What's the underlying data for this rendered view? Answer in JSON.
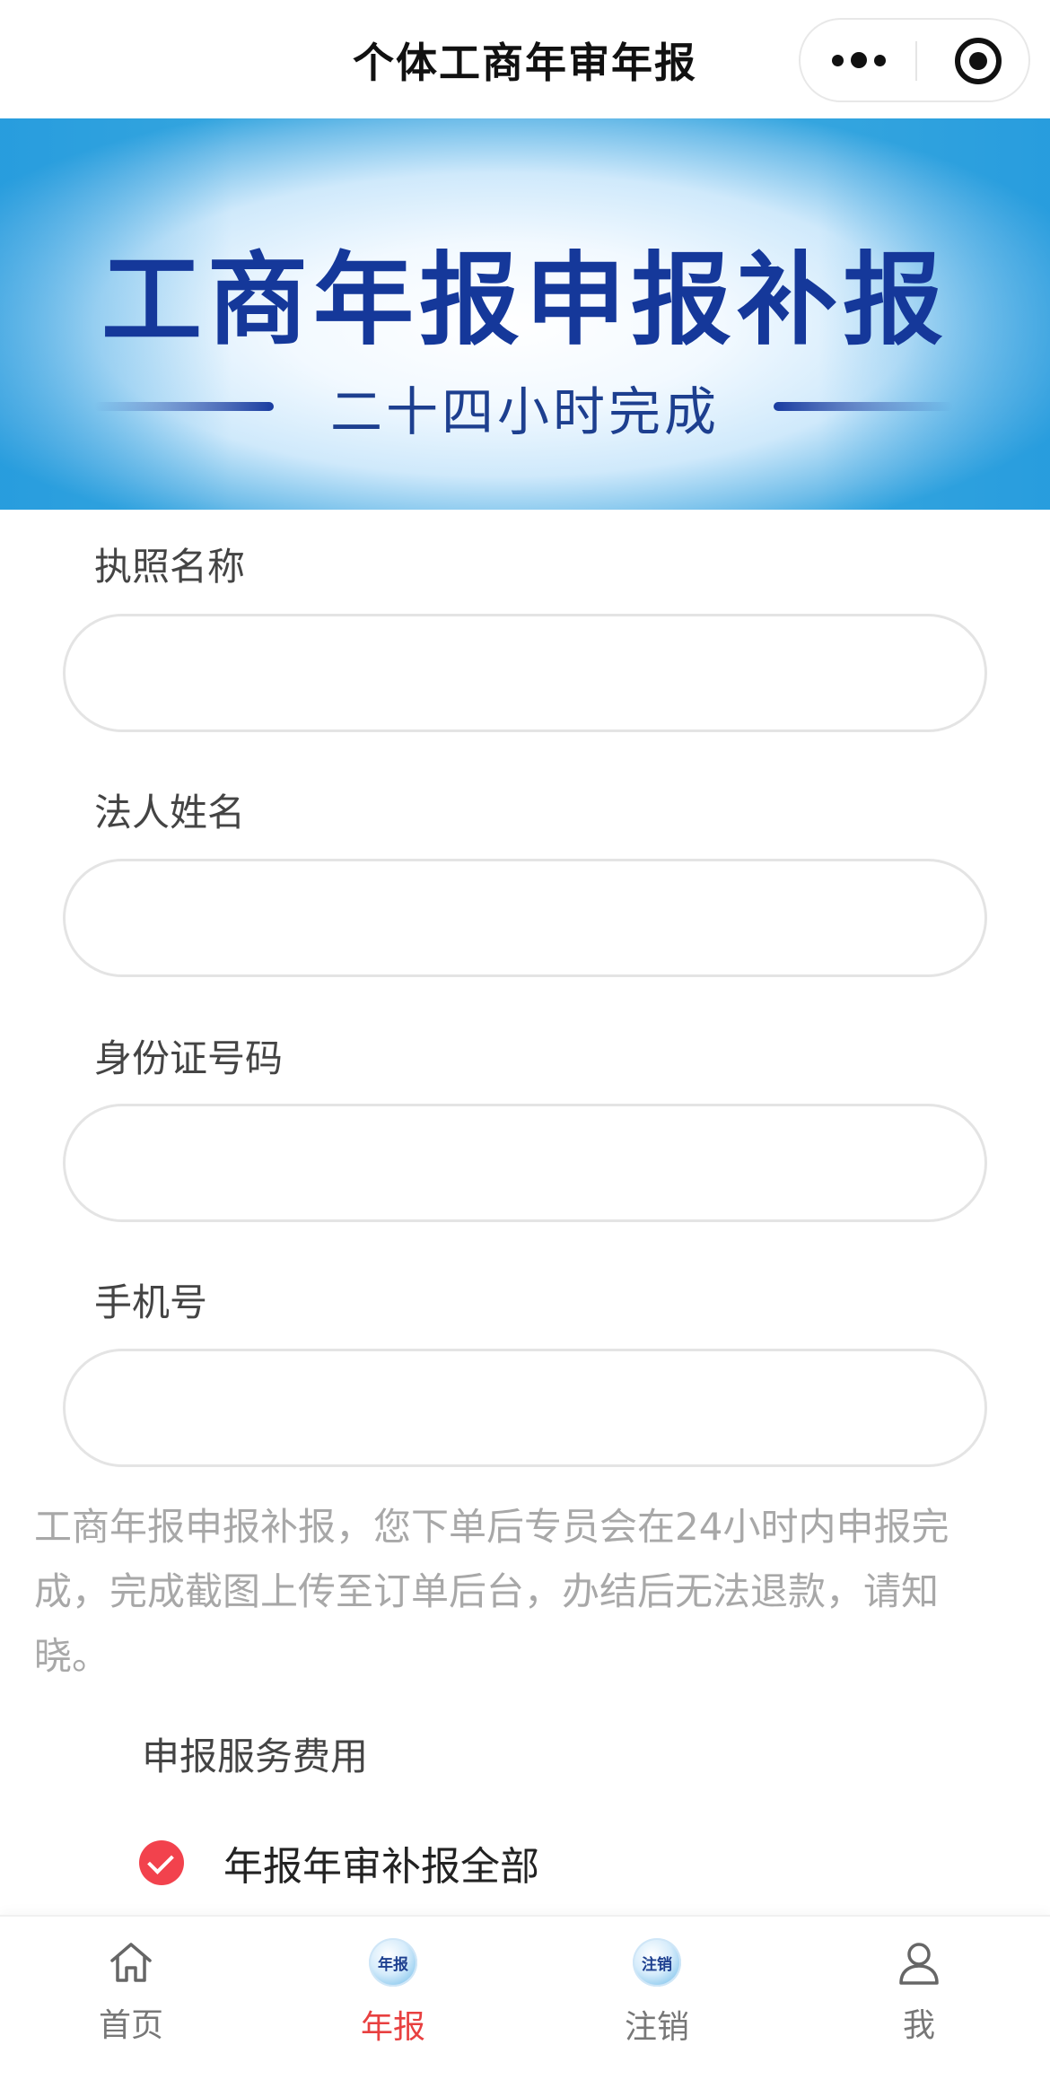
{
  "navbar": {
    "title": "个体工商年审年报"
  },
  "banner": {
    "title": "工商年报申报补报",
    "subtitle": "二十四小时完成"
  },
  "form": {
    "fields": [
      {
        "label": "执照名称",
        "value": "",
        "placeholder": ""
      },
      {
        "label": "法人姓名",
        "value": "",
        "placeholder": ""
      },
      {
        "label": "身份证号码",
        "value": "",
        "placeholder": ""
      },
      {
        "label": "手机号",
        "value": "",
        "placeholder": ""
      }
    ],
    "notice": "工商年报申报补报，您下单后专员会在24小时内申报完成，完成截图上传至订单后台，办结后无法退款，请知晓。",
    "fee_label": "申报服务费用",
    "option_label": "年报年审补报全部",
    "option_selected": true
  },
  "tabbar": {
    "items": [
      {
        "label": "首页",
        "icon": "home-icon",
        "active": false
      },
      {
        "label": "年报",
        "icon": "annual-report-icon",
        "icon_text": "年报",
        "active": true
      },
      {
        "label": "注销",
        "icon": "cancellation-icon",
        "icon_text": "注销",
        "active": false
      },
      {
        "label": "我",
        "icon": "user-icon",
        "active": false
      }
    ]
  },
  "colors": {
    "accent": "#e84040",
    "check": "#f2424d",
    "banner_title": "#15389a",
    "banner_edge": "#34a5df"
  }
}
